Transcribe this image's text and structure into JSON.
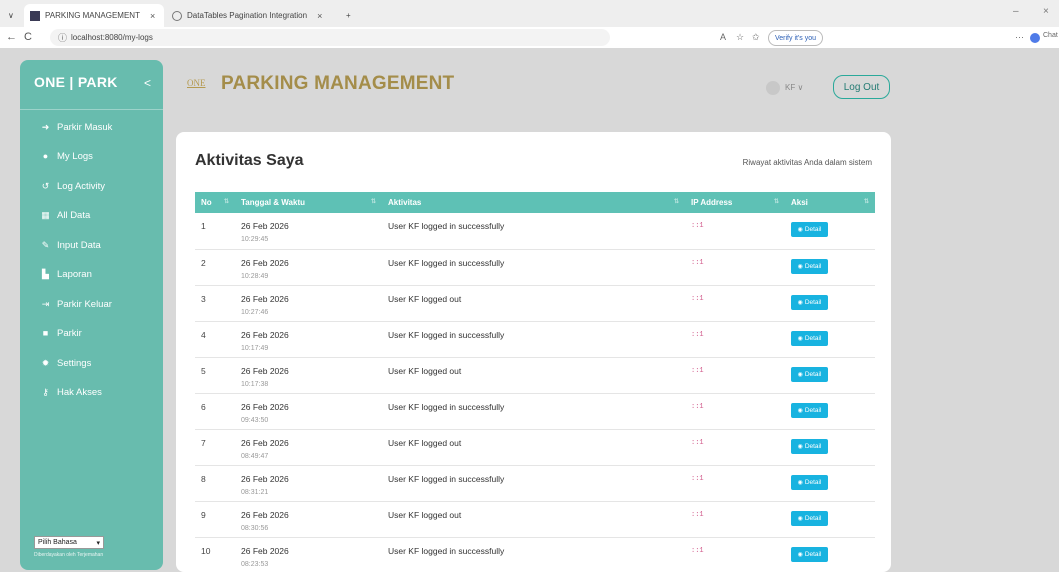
{
  "browser": {
    "tabs": [
      {
        "label": "PARKING MANAGEMENT",
        "close": "×"
      },
      {
        "label": "DataTables Pagination Integration",
        "close": "×"
      }
    ],
    "new_tab": "+",
    "url": "localhost:8080/my-logs",
    "verify_label": "Verify it's you",
    "copilot_label": "Chat",
    "more": "···"
  },
  "sidebar": {
    "brand": "ONE | PARK",
    "collapse_icon": "<",
    "items": [
      {
        "label": "Parkir Masuk",
        "icon": "sign-in-icon"
      },
      {
        "label": "My Logs",
        "icon": "users-icon"
      },
      {
        "label": "Log Activity",
        "icon": "history-icon"
      },
      {
        "label": "All Data",
        "icon": "table-icon"
      },
      {
        "label": "Input Data",
        "icon": "pencil-icon"
      },
      {
        "label": "Laporan",
        "icon": "report-icon"
      },
      {
        "label": "Parkir Keluar",
        "icon": "sign-out-icon"
      },
      {
        "label": "Parkir",
        "icon": "parking-icon"
      },
      {
        "label": "Settings",
        "icon": "gear-icon"
      },
      {
        "label": "Hak Akses",
        "icon": "key-icon"
      }
    ],
    "language": {
      "selected": "Pilih Bahasa",
      "credit": "Diberdayakan oleh Terjemahan"
    }
  },
  "header": {
    "logo_text": "ONE",
    "title": "PARKING MANAGEMENT",
    "user": "KF ∨",
    "logout_label": "Log Out"
  },
  "card": {
    "title": "Aktivitas Saya",
    "subtitle": "Riwayat aktivitas Anda dalam sistem",
    "columns": [
      "No",
      "Tanggal & Waktu",
      "Aktivitas",
      "IP Address",
      "Aksi"
    ],
    "detail_label": "Detail",
    "rows": [
      {
        "no": "1",
        "date": "26 Feb 2026",
        "time": "10:29:45",
        "activity": "User KF logged in successfully",
        "ip": "::1"
      },
      {
        "no": "2",
        "date": "26 Feb 2026",
        "time": "10:28:49",
        "activity": "User KF logged in successfully",
        "ip": "::1"
      },
      {
        "no": "3",
        "date": "26 Feb 2026",
        "time": "10:27:46",
        "activity": "User KF logged out",
        "ip": "::1"
      },
      {
        "no": "4",
        "date": "26 Feb 2026",
        "time": "10:17:49",
        "activity": "User KF logged in successfully",
        "ip": "::1"
      },
      {
        "no": "5",
        "date": "26 Feb 2026",
        "time": "10:17:38",
        "activity": "User KF logged out",
        "ip": "::1"
      },
      {
        "no": "6",
        "date": "26 Feb 2026",
        "time": "09:43:50",
        "activity": "User KF logged in successfully",
        "ip": "::1"
      },
      {
        "no": "7",
        "date": "26 Feb 2026",
        "time": "08:49:47",
        "activity": "User KF logged out",
        "ip": "::1"
      },
      {
        "no": "8",
        "date": "26 Feb 2026",
        "time": "08:31:21",
        "activity": "User KF logged in successfully",
        "ip": "::1"
      },
      {
        "no": "9",
        "date": "26 Feb 2026",
        "time": "08:30:56",
        "activity": "User KF logged out",
        "ip": "::1"
      },
      {
        "no": "10",
        "date": "26 Feb 2026",
        "time": "08:23:53",
        "activity": "User KF logged in successfully",
        "ip": "::1"
      }
    ]
  },
  "colors": {
    "sidebar": "#68bcae",
    "table_header": "#5ec1b5",
    "detail_button": "#18b3e0",
    "title_gold": "#a48d4a",
    "ip_text": "#d0588a"
  }
}
